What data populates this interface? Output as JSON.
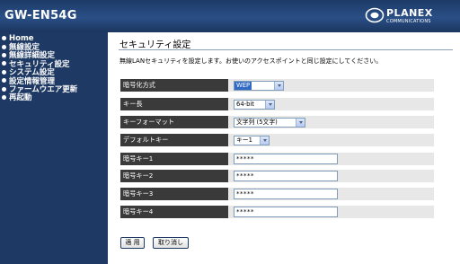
{
  "header": {
    "model": "GW-EN54G",
    "brand_name": "PLANEX",
    "brand_sub": "COMMUNICATIONS"
  },
  "sidebar": {
    "items": [
      {
        "label": "Home"
      },
      {
        "label": "無線設定"
      },
      {
        "label": "無線詳細設定"
      },
      {
        "label": "セキュリティ設定"
      },
      {
        "label": "システム設定"
      },
      {
        "label": "設定情報管理"
      },
      {
        "label": "ファームウエア更新"
      },
      {
        "label": "再起動"
      }
    ]
  },
  "main": {
    "title": "セキュリティ設定",
    "description": "無線LANセキュリティを設定します。お使いのアクセスポイントと同じ設定にしてください。",
    "fields": {
      "encryption": {
        "label": "暗号化方式",
        "value": "WEP"
      },
      "key_length": {
        "label": "キー長",
        "value": "64-bit"
      },
      "key_format": {
        "label": "キーフォーマット",
        "value": "文字列 (5文字)"
      },
      "default_key": {
        "label": "デフォルトキー",
        "value": "キー1"
      },
      "key1": {
        "label": "暗号キー1",
        "value": "*****"
      },
      "key2": {
        "label": "暗号キー2",
        "value": "*****"
      },
      "key3": {
        "label": "暗号キー3",
        "value": "*****"
      },
      "key4": {
        "label": "暗号キー4",
        "value": "*****"
      }
    },
    "buttons": {
      "apply": "適 用",
      "cancel": "取り消し"
    }
  },
  "colors": {
    "header": "#1c3a66",
    "sidebar": "#1e3a64",
    "label_bg": "#3a3a3a",
    "row_bg": "#e7e7e7",
    "selected": "#316ac5"
  },
  "icons": {
    "brand": "planex-logo-icon",
    "nav": "bullet-icon",
    "dropdown": "chevron-down-icon"
  }
}
